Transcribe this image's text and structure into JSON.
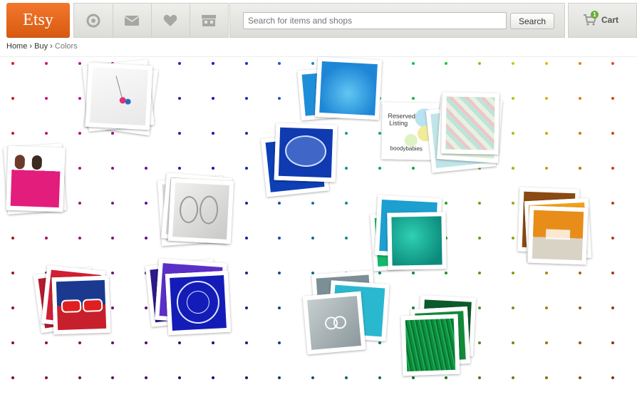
{
  "header": {
    "logo": "Etsy",
    "nav_icons": [
      "activity-icon",
      "mail-icon",
      "heart-icon",
      "shop-icon"
    ],
    "search": {
      "placeholder": "Search for items and shops",
      "button": "Search"
    },
    "cart": {
      "label": "Cart",
      "count": "1"
    }
  },
  "breadcrumb": {
    "home": "Home",
    "buy": "Buy",
    "current": "Colors",
    "separator": "›"
  },
  "reserved_listing": {
    "line1": "Reserved",
    "line2": "Listing",
    "brand": "boodybabies"
  },
  "colors": {
    "brand": "#e0661c",
    "dot_columns": [
      "#d7192b",
      "#d4137a",
      "#c4139a",
      "#a512a3",
      "#7a12b0",
      "#4a12b8",
      "#2216c0",
      "#1830c2",
      "#1c5fc6",
      "#1887c4",
      "#16a8b8",
      "#13b591",
      "#16bb59",
      "#26c72d",
      "#7acb19",
      "#c0cb14",
      "#e2b80f",
      "#e8820f",
      "#e34d15"
    ]
  }
}
